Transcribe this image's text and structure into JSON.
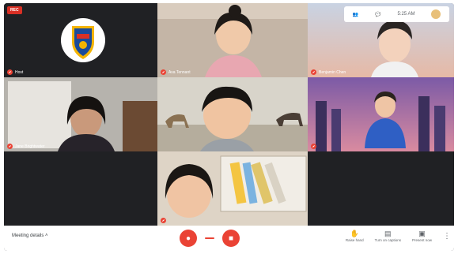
{
  "recording_badge": "REC",
  "top_controls": {
    "time": "5:25 AM",
    "icons": [
      "people-icon",
      "chat-icon"
    ]
  },
  "tiles": [
    {
      "id": "t1",
      "name": "Host",
      "bg": "#202124"
    },
    {
      "id": "t2",
      "name": "Ava Tennant",
      "bg": "#b9a899"
    },
    {
      "id": "t3",
      "name": "Benjamin Chen",
      "bg": "#d7c6c0"
    },
    {
      "id": "t4",
      "name": "Jane Brightwater",
      "bg": "#8d8a86"
    },
    {
      "id": "t5",
      "name": "",
      "bg": "#c9c3b6"
    },
    {
      "id": "t6",
      "name": "",
      "bg": "#6a4f8c"
    },
    {
      "id": "t7",
      "name": "",
      "bg": "#202124"
    },
    {
      "id": "t8",
      "name": "",
      "bg": "#d2c6b6"
    },
    {
      "id": "t9",
      "name": "",
      "bg": "#202124"
    }
  ],
  "bottom_bar": {
    "meeting_details": "Meeting details",
    "buttons": {
      "raise_hand": "Raise hand",
      "turn_on_captions": "Turn on captions",
      "present_now": "Present now"
    }
  },
  "colors": {
    "accent_red": "#ea4335",
    "dark": "#202124"
  }
}
